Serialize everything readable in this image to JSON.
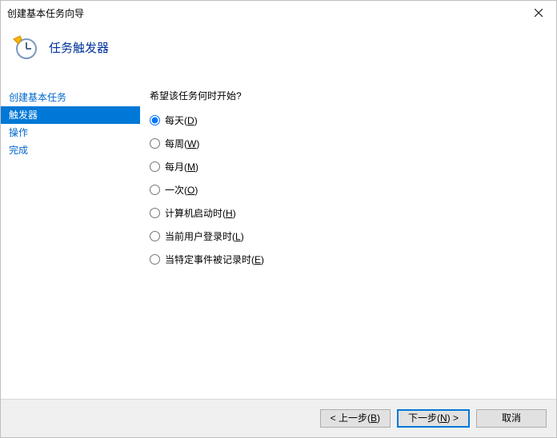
{
  "window": {
    "title": "创建基本任务向导"
  },
  "header": {
    "heading": "任务触发器"
  },
  "sidebar": {
    "steps": [
      {
        "label": "创建基本任务",
        "active": false
      },
      {
        "label": "触发器",
        "active": true
      },
      {
        "label": "操作",
        "active": false
      },
      {
        "label": "完成",
        "active": false
      }
    ]
  },
  "content": {
    "prompt": "希望该任务何时开始?",
    "options": [
      {
        "label": "每天",
        "mnemonic": "D",
        "selected": true
      },
      {
        "label": "每周",
        "mnemonic": "W",
        "selected": false
      },
      {
        "label": "每月",
        "mnemonic": "M",
        "selected": false
      },
      {
        "label": "一次",
        "mnemonic": "O",
        "selected": false
      },
      {
        "label": "计算机启动时",
        "mnemonic": "H",
        "selected": false
      },
      {
        "label": "当前用户登录时",
        "mnemonic": "L",
        "selected": false
      },
      {
        "label": "当特定事件被记录时",
        "mnemonic": "E",
        "selected": false
      }
    ]
  },
  "footer": {
    "back": {
      "prefix": "< 上一步(",
      "mnemonic": "B",
      "suffix": ")"
    },
    "next": {
      "prefix": "下一步(",
      "mnemonic": "N",
      "suffix": ") >"
    },
    "cancel": {
      "label": "取消"
    }
  },
  "icons": {
    "clock": "clock-icon",
    "close": "close-icon"
  }
}
